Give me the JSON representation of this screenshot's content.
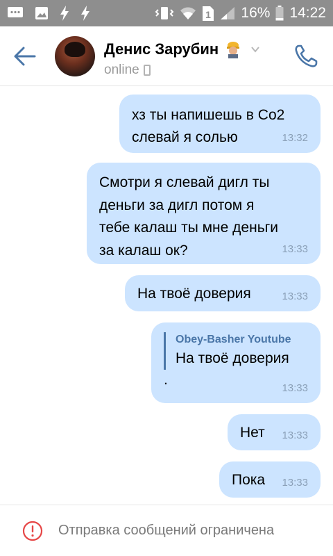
{
  "status_bar": {
    "battery_percent": "16%",
    "time": "14:22",
    "sim_slot": "1",
    "icons": [
      "message-icon",
      "image-icon",
      "bolt-icon",
      "bolt-icon",
      "vibrate-icon",
      "wifi-icon",
      "signal-icon",
      "battery-icon"
    ]
  },
  "header": {
    "contact_name": "Денис Зарубин",
    "status": "online",
    "colors": {
      "accent": "#4a76a8"
    }
  },
  "messages": [
    {
      "text": "хз ты напишешь в Со2\nслевай я солью",
      "time": "13:32"
    },
    {
      "text": "Смотри я слевай дигл ты\nденьги за дигл потом я\nтебе калаш ты мне деньги\nза калаш ок?",
      "time": "13:33"
    },
    {
      "text": "На твоё доверия",
      "time": "13:33"
    },
    {
      "quote_author": "Obey-Basher Youtube",
      "quote_text": "На твоё доверия",
      "text": ".",
      "time": "13:33"
    },
    {
      "text": "Нет",
      "time": "13:33"
    },
    {
      "text": "Пока",
      "time": "13:33"
    }
  ],
  "footer": {
    "notice": "Отправка сообщений ограничена"
  },
  "colors": {
    "bubble": "#cce4ff",
    "accent": "#4a76a8",
    "warning": "#e64646",
    "status_bar": "#8e8e8e"
  }
}
